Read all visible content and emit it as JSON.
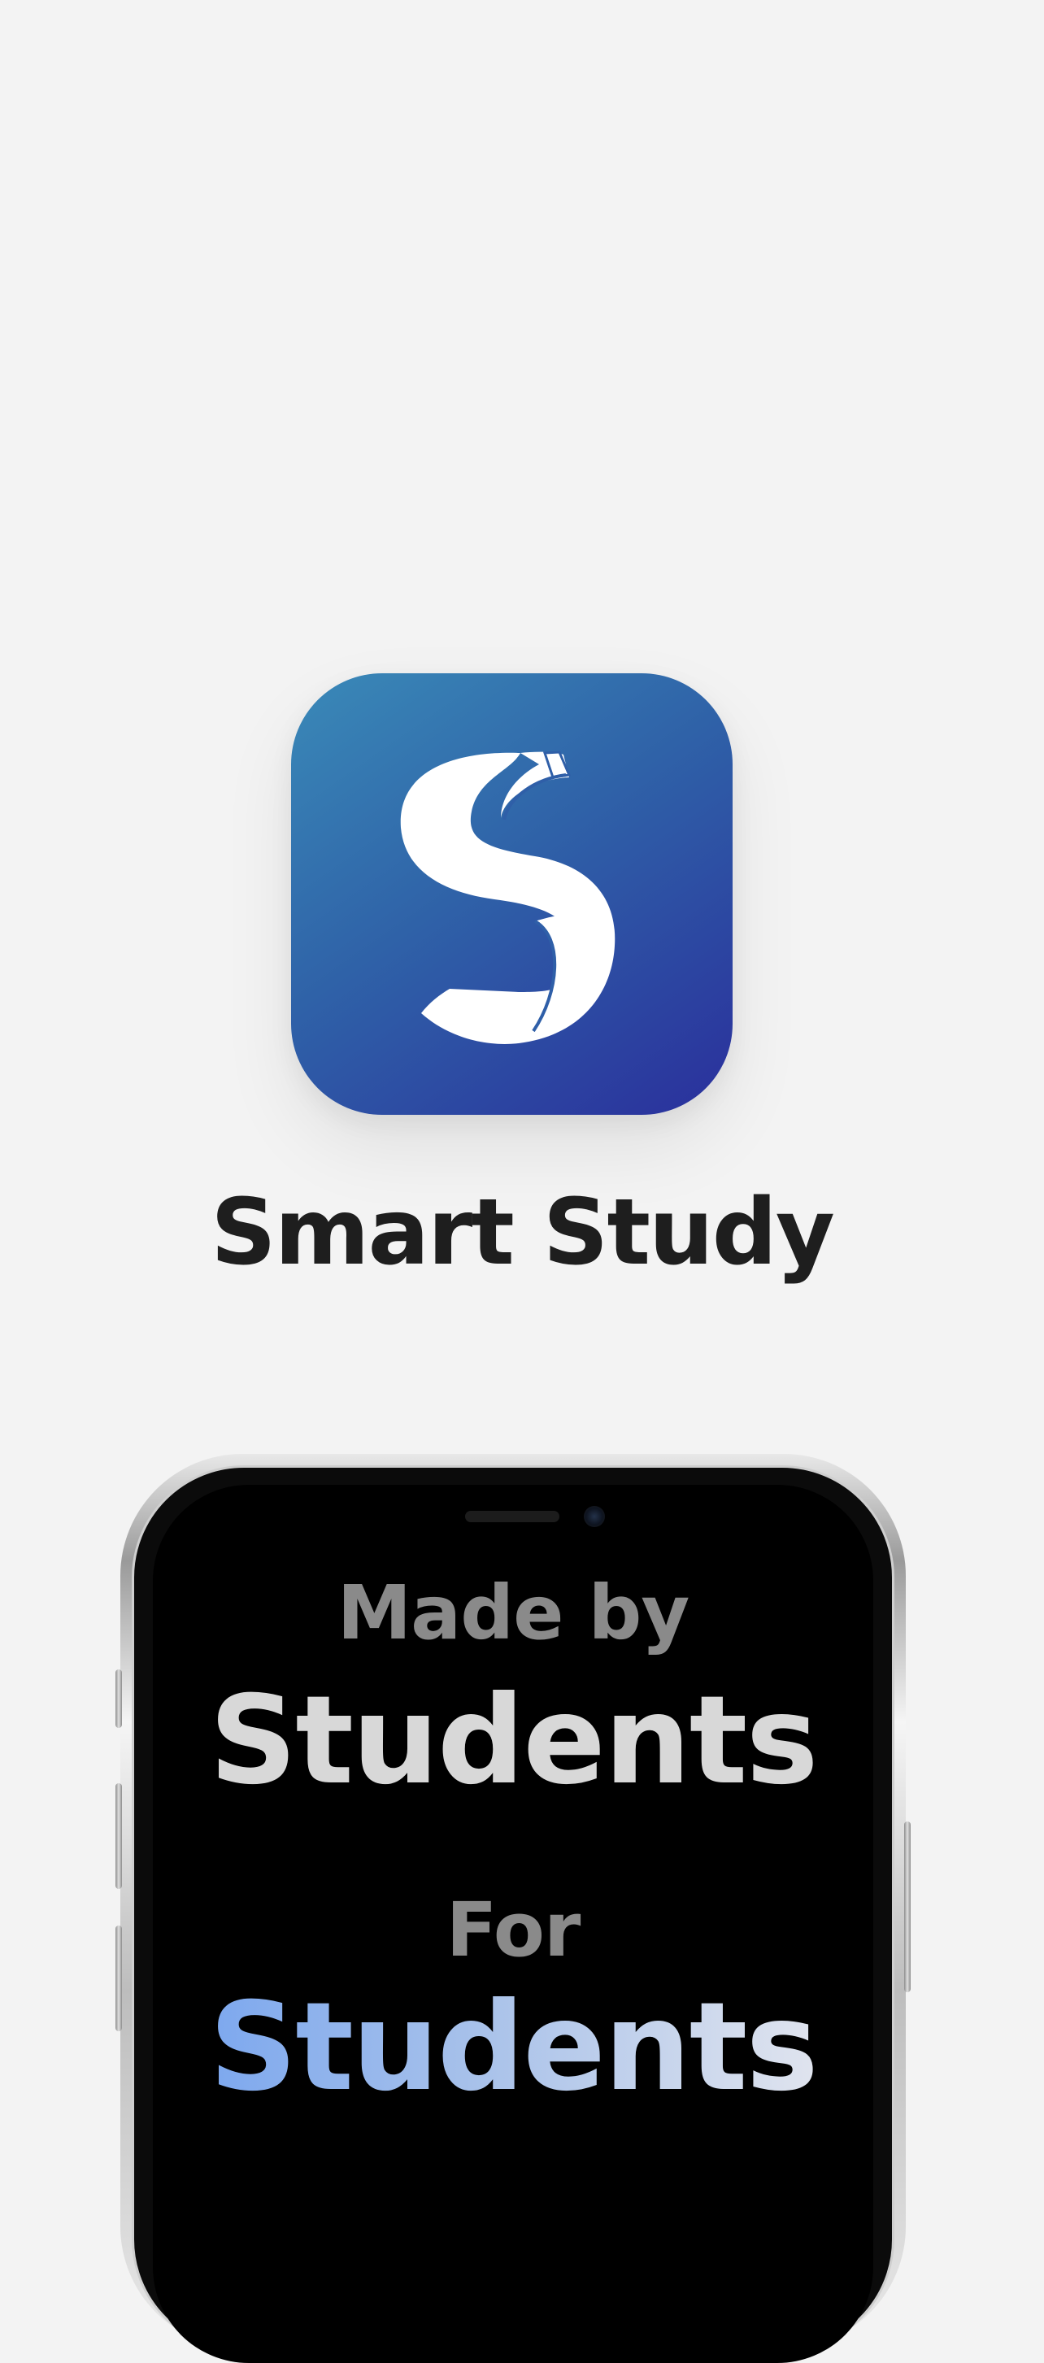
{
  "app": {
    "name": "Smart Study",
    "icon": "smart-study-s-logo",
    "icon_gradient": [
      "#3a8ab8",
      "#2a2f9c"
    ]
  },
  "phone": {
    "tagline": {
      "line1": "Made by",
      "line2": "Students",
      "line3": "For",
      "line4": "Students"
    },
    "colors": {
      "muted": "#8a8a8a",
      "light": "#d8d8d8",
      "accent_gradient": [
        "#7da8ee",
        "#e0e4ee"
      ]
    }
  }
}
